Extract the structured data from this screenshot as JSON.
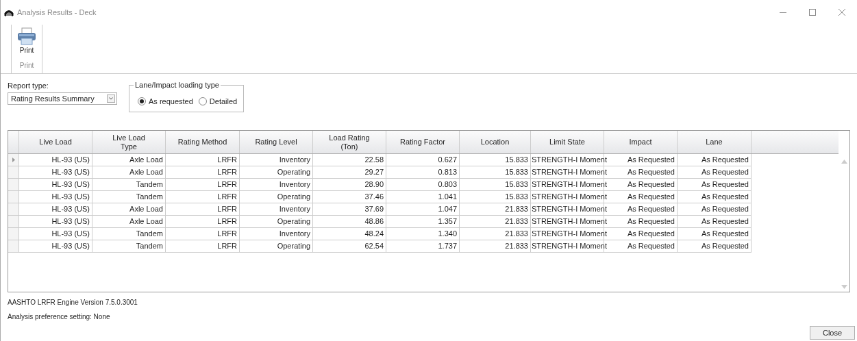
{
  "window": {
    "title": "Analysis Results - Deck"
  },
  "ribbon": {
    "groups": [
      {
        "label": "Print",
        "buttons": [
          {
            "label": "Print"
          }
        ]
      }
    ]
  },
  "report_type": {
    "label": "Report type:",
    "value": "Rating Results Summary"
  },
  "loading_type": {
    "legend": "Lane/Impact loading type",
    "options": [
      {
        "label": "As requested",
        "selected": true
      },
      {
        "label": "Detailed",
        "selected": false
      }
    ]
  },
  "table": {
    "columns": [
      "Live Load",
      "Live Load\nType",
      "Rating Method",
      "Rating Level",
      "Load Rating\n(Ton)",
      "Rating Factor",
      "Location",
      "Limit State",
      "Impact",
      "Lane"
    ],
    "rows": [
      {
        "current": true,
        "cells": [
          "HL-93 (US)",
          "Axle Load",
          "LRFR",
          "Inventory",
          "22.58",
          "0.627",
          "15.833",
          "STRENGTH-I Moment",
          "As Requested",
          "As Requested"
        ]
      },
      {
        "current": false,
        "cells": [
          "HL-93 (US)",
          "Axle Load",
          "LRFR",
          "Operating",
          "29.27",
          "0.813",
          "15.833",
          "STRENGTH-I Moment",
          "As Requested",
          "As Requested"
        ]
      },
      {
        "current": false,
        "cells": [
          "HL-93 (US)",
          "Tandem",
          "LRFR",
          "Inventory",
          "28.90",
          "0.803",
          "15.833",
          "STRENGTH-I Moment",
          "As Requested",
          "As Requested"
        ]
      },
      {
        "current": false,
        "cells": [
          "HL-93 (US)",
          "Tandem",
          "LRFR",
          "Operating",
          "37.46",
          "1.041",
          "15.833",
          "STRENGTH-I Moment",
          "As Requested",
          "As Requested"
        ]
      },
      {
        "current": false,
        "cells": [
          "HL-93 (US)",
          "Axle Load",
          "LRFR",
          "Inventory",
          "37.69",
          "1.047",
          "21.833",
          "STRENGTH-I Moment",
          "As Requested",
          "As Requested"
        ]
      },
      {
        "current": false,
        "cells": [
          "HL-93 (US)",
          "Axle Load",
          "LRFR",
          "Operating",
          "48.86",
          "1.357",
          "21.833",
          "STRENGTH-I Moment",
          "As Requested",
          "As Requested"
        ]
      },
      {
        "current": false,
        "cells": [
          "HL-93 (US)",
          "Tandem",
          "LRFR",
          "Inventory",
          "48.24",
          "1.340",
          "21.833",
          "STRENGTH-I Moment",
          "As Requested",
          "As Requested"
        ]
      },
      {
        "current": false,
        "cells": [
          "HL-93 (US)",
          "Tandem",
          "LRFR",
          "Operating",
          "62.54",
          "1.737",
          "21.833",
          "STRENGTH-I Moment",
          "As Requested",
          "As Requested"
        ]
      }
    ]
  },
  "footer_lines": [
    "AASHTO LRFR Engine Version 7.5.0.3001",
    "Analysis preference setting: None"
  ],
  "buttons": [
    "Close"
  ]
}
